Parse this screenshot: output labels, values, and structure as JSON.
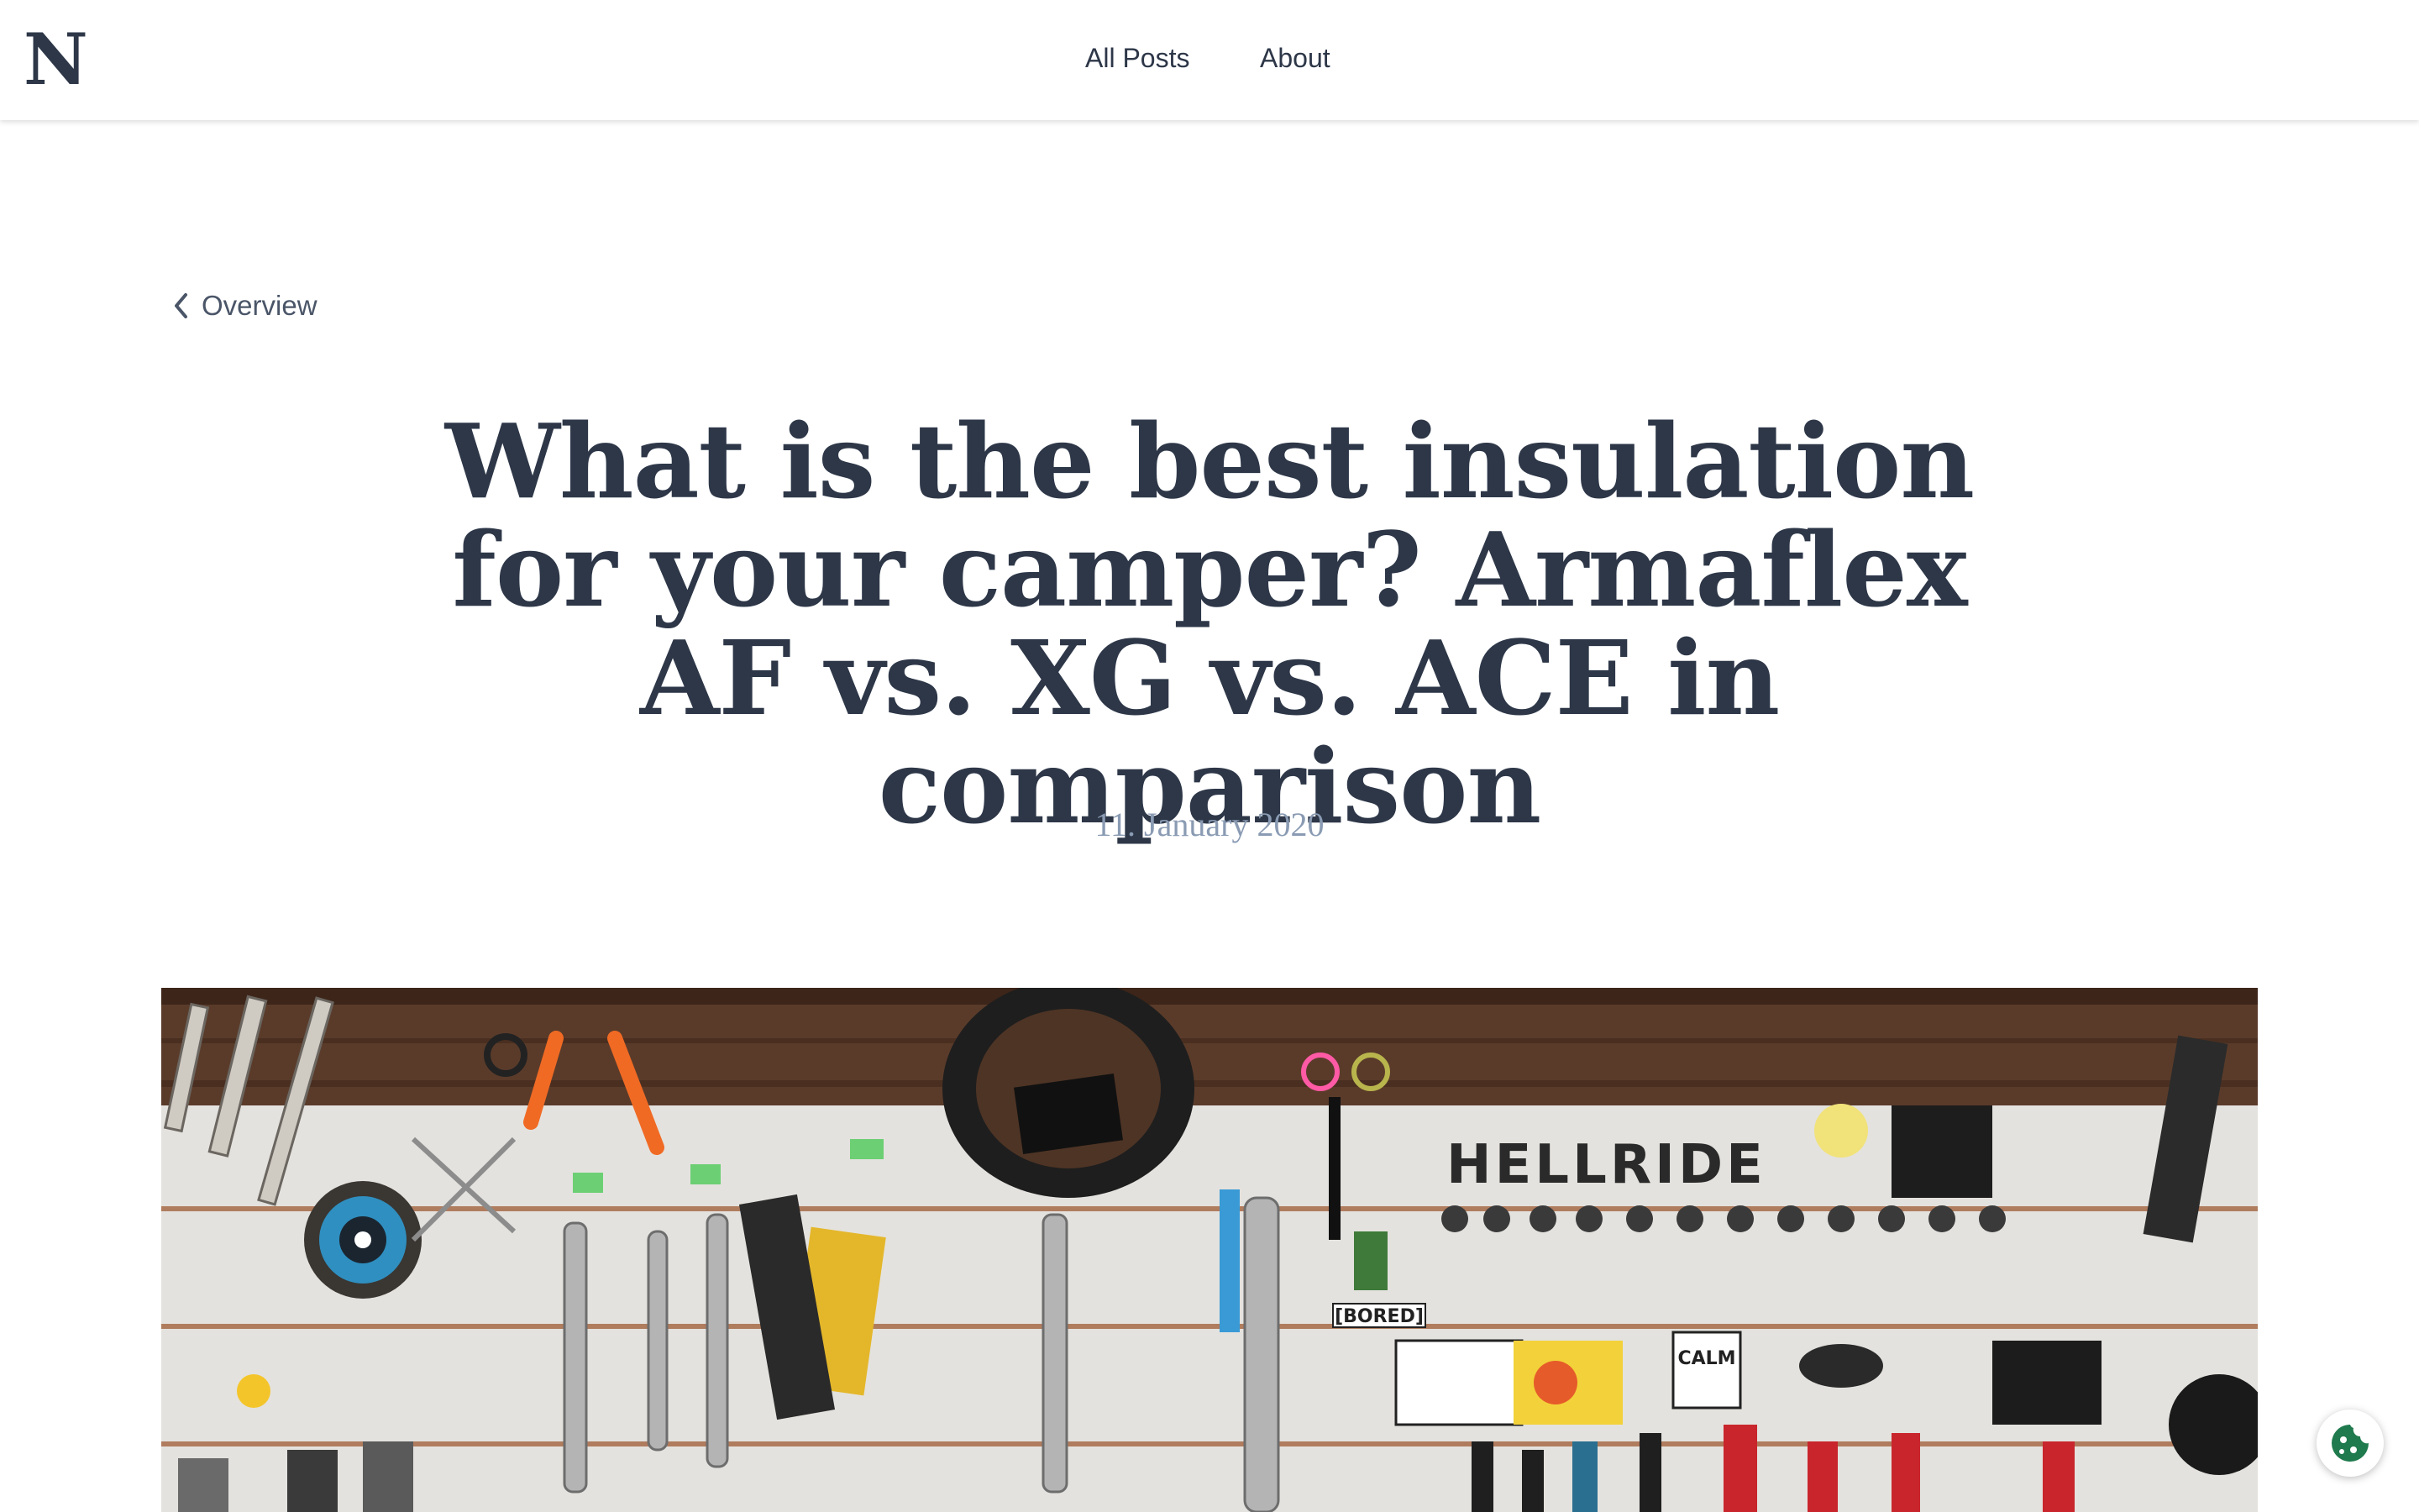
{
  "header": {
    "logo_text": "N",
    "nav": [
      {
        "label": "All Posts"
      },
      {
        "label": "About"
      }
    ]
  },
  "back_link": {
    "label": "Overview",
    "icon": "chevron-left-icon"
  },
  "article": {
    "title": "What is the best insulation for your camper? Armaflex AF vs. XG vs. ACE in comparison",
    "date": "11. January 2020"
  },
  "hero_image": {
    "description_icon": "workshop-tool-wall-image",
    "sign_hellride": "HELLRIDE",
    "sticker_bored": "[BORED]",
    "sticker_calm": "CALM"
  },
  "cookie_button": {
    "icon": "cookie-icon",
    "color": "#1f7a4d"
  },
  "colors": {
    "text": "#2d3748",
    "muted": "#8a9bb3",
    "link": "#4a5568"
  }
}
